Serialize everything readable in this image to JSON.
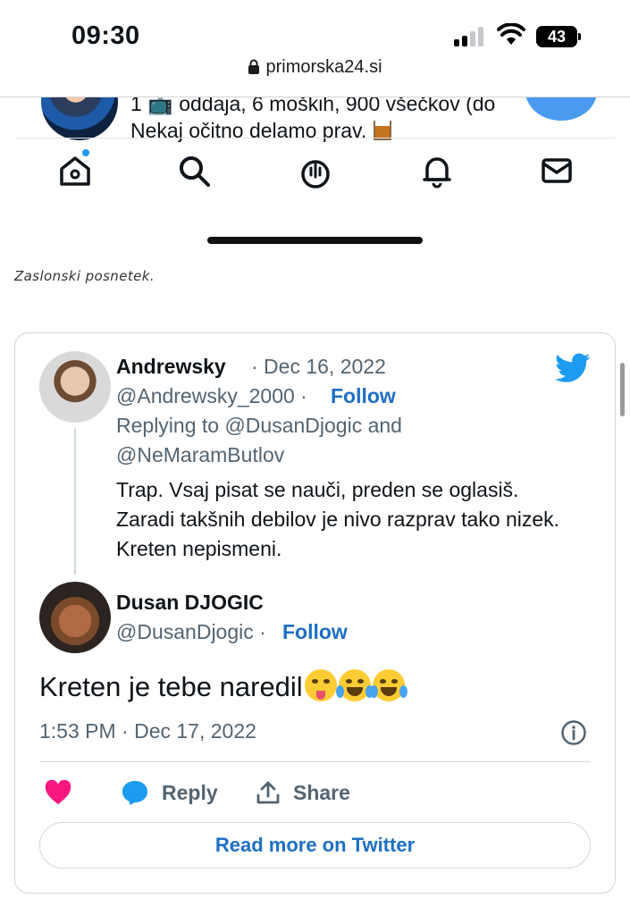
{
  "status_bar": {
    "time": "09:30",
    "battery": "43"
  },
  "browser": {
    "url": "primorska24.si"
  },
  "embedded_screenshot": {
    "line1": "1 📺 oddaja, 6 moških, 900 všečkov (do",
    "line2": "Nekaj očitno delamo prav.",
    "nav_icons": [
      "home-icon",
      "search-icon",
      "spaces-icon",
      "notifications-icon",
      "messages-icon"
    ]
  },
  "caption": "Zaslonski posnetek.",
  "tweet": {
    "parent": {
      "name": "Andrewsky",
      "date": "· Dec 16, 2022",
      "handle": "@Andrewsky_2000 ·",
      "follow": "Follow",
      "replying_line1": "Replying to @DusanDjogic and",
      "replying_line2": "@NeMaramButlov",
      "text": "Trap. Vsaj pisat se nauči, preden se oglasiš. Zaradi takšnih debilov je nivo razprav tako nizek. Kreten nepismeni."
    },
    "reply": {
      "name": "Dusan DJOGIC",
      "handle": "@DusanDjogic ·",
      "follow": "Follow",
      "text": "Kreten je tebe naredil",
      "timestamp": "1:53 PM · Dec 17, 2022"
    },
    "actions": {
      "reply": "Reply",
      "share": "Share"
    },
    "read_more": "Read more on Twitter",
    "colors": {
      "accent": "#1d9bf0",
      "link": "#1d6fc4",
      "like": "#f91880",
      "muted": "#536471"
    }
  }
}
